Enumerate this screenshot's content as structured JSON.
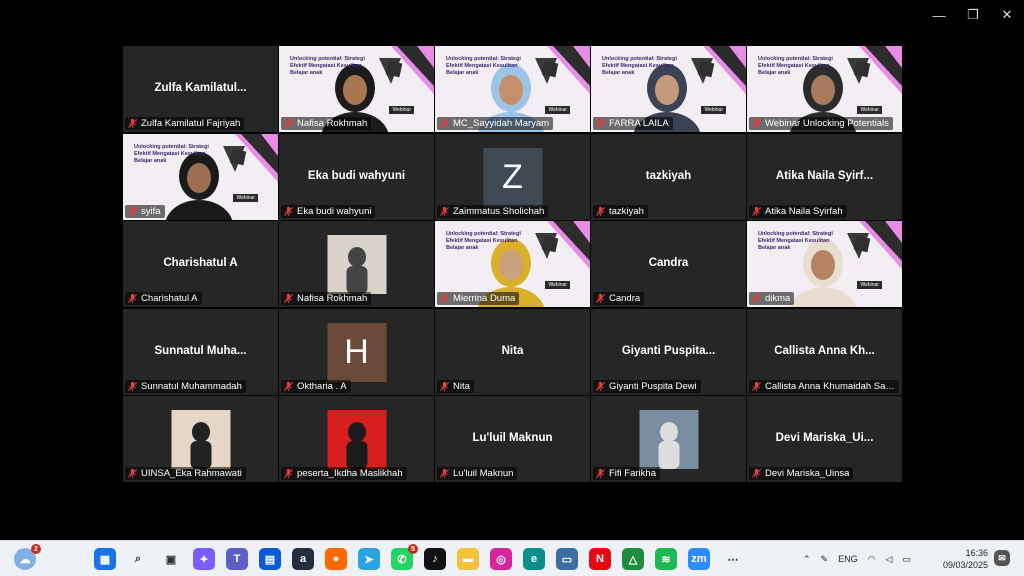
{
  "window": {
    "minimize": "—",
    "restore": "❐",
    "close": "✕"
  },
  "slide": {
    "title": "Unlocking potential: Strategi Efektif Mengatasi Kesulitan Belajar anak",
    "tag": "Webinar"
  },
  "participants": [
    {
      "tile_name": "Zulfa  Kamilatul...",
      "label": "Zulfa Kamilatul Fajriyah",
      "kind": "name"
    },
    {
      "label": "Nafisa Rokhmah",
      "kind": "video",
      "skin": "#a8764f",
      "hijab": "#1c1c1c"
    },
    {
      "label": "MC_Sayyidah Maryam",
      "kind": "video",
      "skin": "#c4906b",
      "hijab": "#9cc4e4",
      "active": true
    },
    {
      "label": "FARRA LAILA",
      "kind": "video",
      "skin": "#c49a7c",
      "hijab": "#3a4254"
    },
    {
      "label": "Webinar Unlocking Potentials",
      "kind": "video",
      "skin": "#a87b5e",
      "hijab": "#2b2b2b"
    },
    {
      "label": "syifa",
      "kind": "video",
      "skin": "#9c6e52",
      "hijab": "#1a1a1a"
    },
    {
      "tile_name": "Eka budi wahyuni",
      "label": "Eka budi wahyuni",
      "kind": "name"
    },
    {
      "avatar_letter": "Z",
      "label": "Zaimmatus Sholichah",
      "kind": "avatar",
      "color": "#3f4a55"
    },
    {
      "tile_name": "tazkiyah",
      "label": "tazkiyah",
      "kind": "name"
    },
    {
      "tile_name": "Atika Naila Syirf...",
      "label": "Atika Naila Syirfah",
      "kind": "name"
    },
    {
      "tile_name": "Charishatul A",
      "label": "Charishatul A",
      "kind": "name"
    },
    {
      "label": "Nafisa Rokhmah",
      "kind": "photo",
      "bg": "#d9d2c8",
      "fig": "#444"
    },
    {
      "label": "Mierrina Duma",
      "kind": "video",
      "skin": "#caa07f",
      "hijab": "#d8b02a"
    },
    {
      "tile_name": "Candra",
      "label": "Candra",
      "kind": "name"
    },
    {
      "label": "dikma",
      "kind": "video",
      "skin": "#b58364",
      "hijab": "#e9ddd0"
    },
    {
      "tile_name": "Sunnatul  Muha...",
      "label": "Sunnatul Muhammadah",
      "kind": "name"
    },
    {
      "avatar_letter": "H",
      "label": "Oktharia . A",
      "kind": "avatar",
      "color": "#6b4a3a"
    },
    {
      "tile_name": "Nita",
      "label": "Nita",
      "kind": "name"
    },
    {
      "tile_name": "Giyanti  Puspita...",
      "label": "Giyanti Puspita Dewi",
      "kind": "name"
    },
    {
      "tile_name": "Callista  Anna  Kh...",
      "label": "Callista Anna Khumaidah Sal...",
      "kind": "name"
    },
    {
      "label": "UINSA_Eka Rahmawati",
      "kind": "photo",
      "bg": "#e6d6c8",
      "fig": "#222"
    },
    {
      "label": "peserta_Ikdha Maslikhah",
      "kind": "photo",
      "bg": "#d81f1f",
      "fig": "#1c1c1c"
    },
    {
      "tile_name": "Lu'luil Maknun",
      "label": "Lu'luil Maknun",
      "kind": "name"
    },
    {
      "label": "Fifi Farikha",
      "kind": "photo",
      "bg": "#7a8ca0",
      "fig": "#ddd"
    },
    {
      "tile_name": "Devi  Mariska_Ui...",
      "label": "Devi Mariska_Uinsa",
      "kind": "name"
    }
  ],
  "taskbar": {
    "weather_badge": "2",
    "whatsapp_badge": "5",
    "apps": [
      {
        "name": "windows-start",
        "glyph": "▦",
        "color": "#1a73e8"
      },
      {
        "name": "search",
        "glyph": "⌕",
        "color": "#333"
      },
      {
        "name": "task-view",
        "glyph": "▣",
        "color": "#333"
      },
      {
        "name": "copilot",
        "glyph": "✦",
        "color": "#7b5cff"
      },
      {
        "name": "teams",
        "glyph": "T",
        "color": "#5b5fc7"
      },
      {
        "name": "store",
        "glyph": "▤",
        "color": "#0a5bd6"
      },
      {
        "name": "amazon",
        "glyph": "a",
        "color": "#232f3e"
      },
      {
        "name": "firefox",
        "glyph": "●",
        "color": "#ff6a00"
      },
      {
        "name": "telegram",
        "glyph": "➤",
        "color": "#2aa3e0"
      },
      {
        "name": "whatsapp",
        "glyph": "✆",
        "color": "#25d366"
      },
      {
        "name": "tiktok",
        "glyph": "♪",
        "color": "#111"
      },
      {
        "name": "file-explorer",
        "glyph": "▬",
        "color": "#f3c23a"
      },
      {
        "name": "instagram",
        "glyph": "◎",
        "color": "#d6249f"
      },
      {
        "name": "edge",
        "glyph": "e",
        "color": "#0c8f8b"
      },
      {
        "name": "remote-desktop",
        "glyph": "▭",
        "color": "#3a6ea5"
      },
      {
        "name": "netflix",
        "glyph": "N",
        "color": "#e50914"
      },
      {
        "name": "drive",
        "glyph": "△",
        "color": "#1e8e3e"
      },
      {
        "name": "spotify",
        "glyph": "≋",
        "color": "#1db954"
      },
      {
        "name": "zoom",
        "glyph": "zm",
        "color": "#2d8cff"
      },
      {
        "name": "more",
        "glyph": "⋯",
        "color": "#333"
      }
    ],
    "lang": "ENG",
    "time": "16:36",
    "date": "09/03/2025"
  }
}
